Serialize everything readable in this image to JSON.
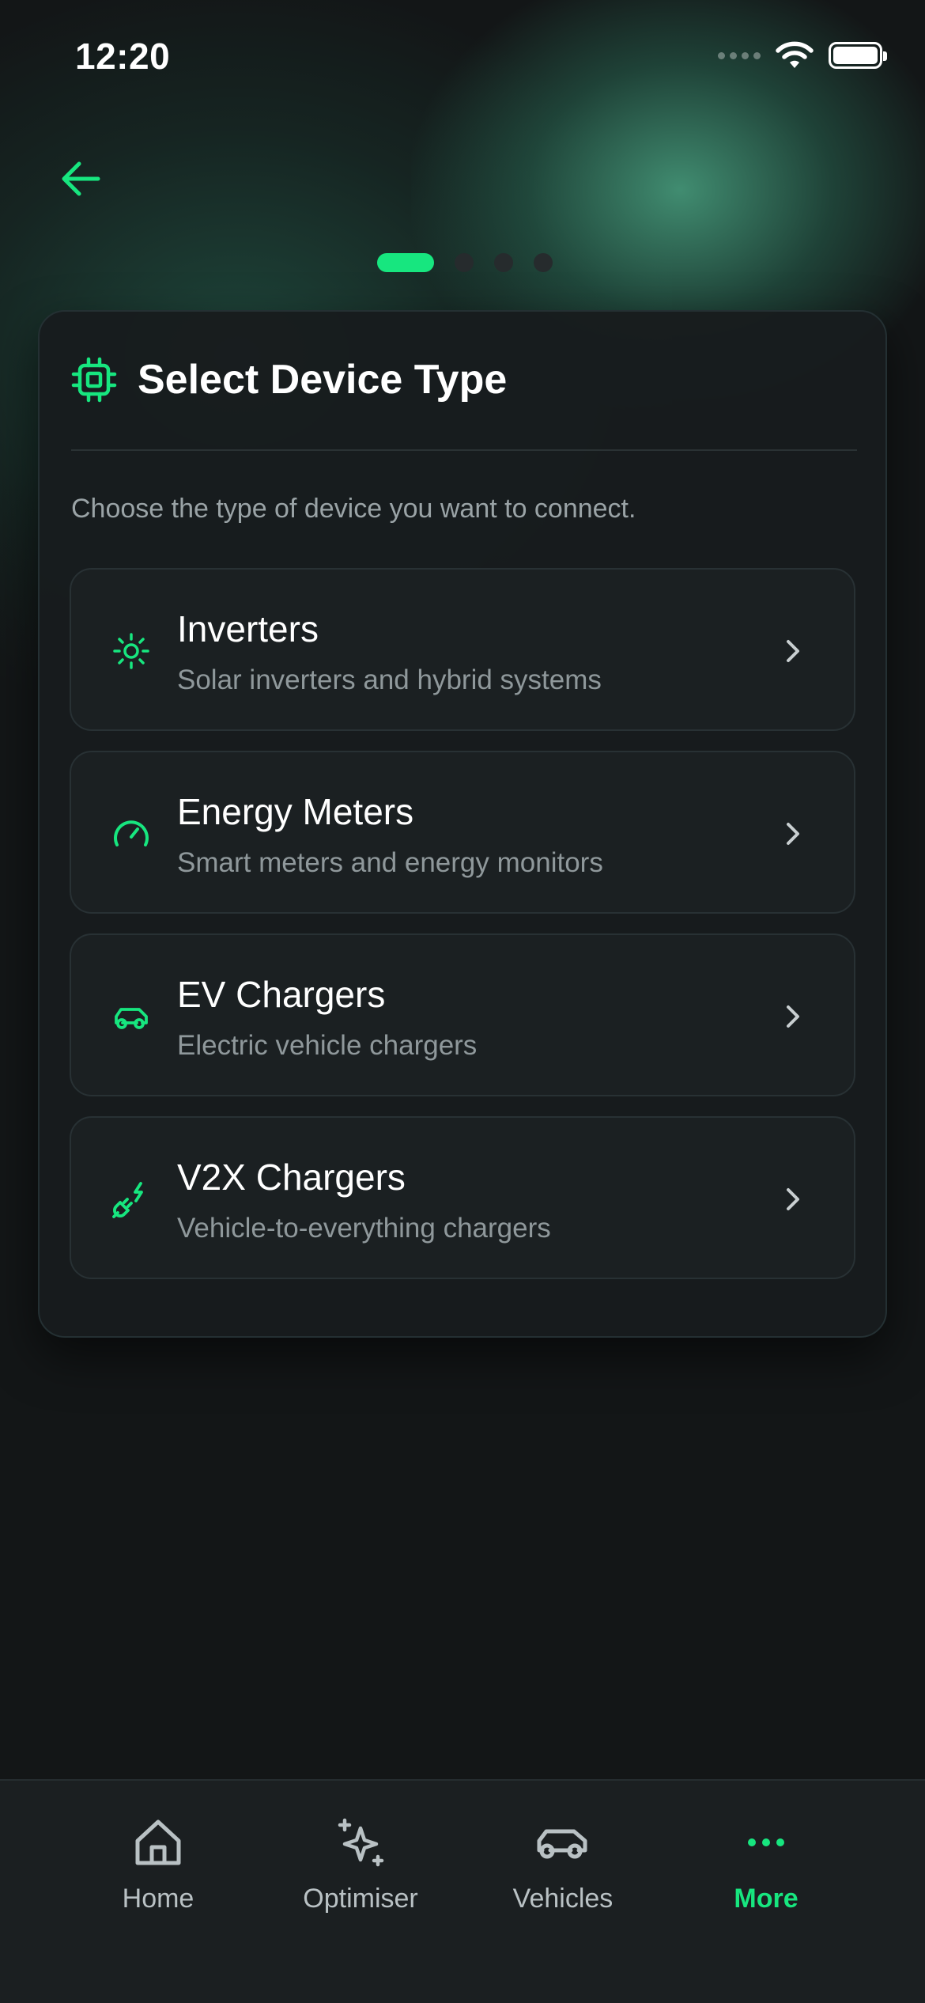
{
  "status_bar": {
    "time": "12:20"
  },
  "pager": {
    "total": 4,
    "active_index": 0
  },
  "card": {
    "title": "Select Device Type",
    "subtitle": "Choose the type of device you want to connect."
  },
  "devices": [
    {
      "name": "Inverters",
      "description": "Solar inverters and hybrid systems",
      "icon": "sun-icon"
    },
    {
      "name": "Energy Meters",
      "description": "Smart meters and energy monitors",
      "icon": "gauge-icon"
    },
    {
      "name": "EV Chargers",
      "description": "Electric vehicle chargers",
      "icon": "car-icon"
    },
    {
      "name": "V2X Chargers",
      "description": "Vehicle-to-everything chargers",
      "icon": "plug-icon"
    }
  ],
  "tab_bar": {
    "items": [
      {
        "label": "Home",
        "icon": "home-icon",
        "active": false
      },
      {
        "label": "Optimiser",
        "icon": "sparkles-icon",
        "active": false
      },
      {
        "label": "Vehicles",
        "icon": "car-icon",
        "active": false
      },
      {
        "label": "More",
        "icon": "more-icon",
        "active": true
      }
    ]
  },
  "colors": {
    "accent": "#17e67f",
    "background": "#131617",
    "card": "#181c1e",
    "muted_text": "#8f989b"
  }
}
